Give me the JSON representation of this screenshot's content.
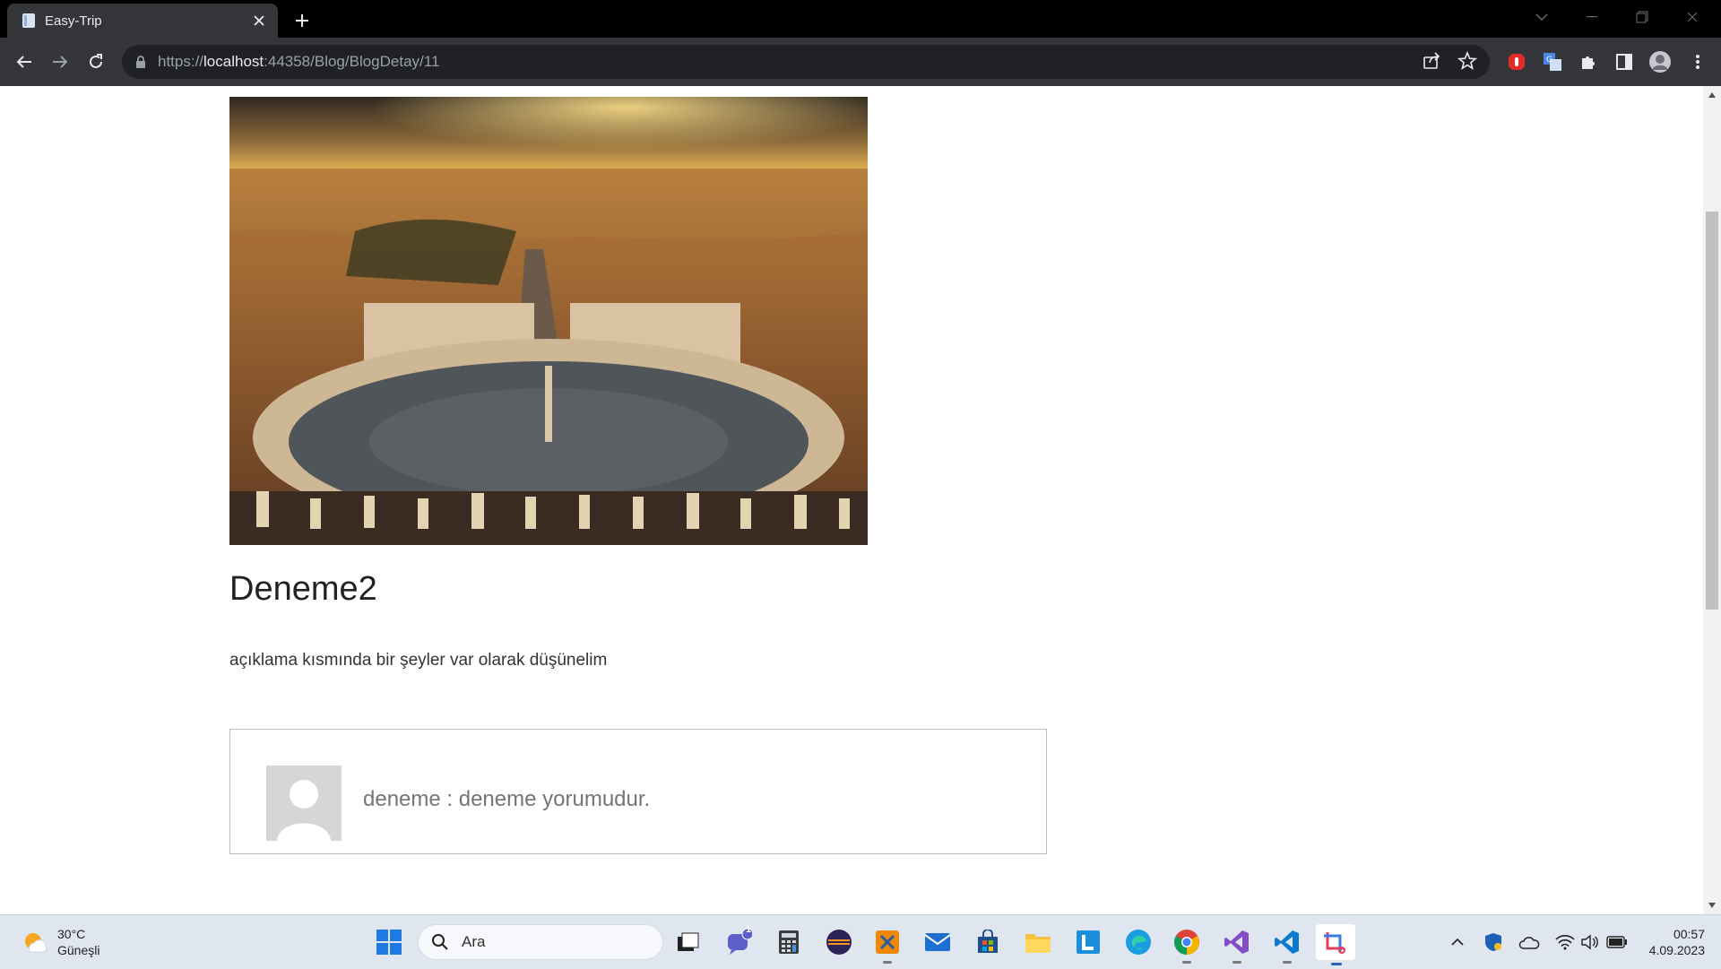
{
  "browser": {
    "tab_title": "Easy-Trip",
    "url_scheme": "https://",
    "url_host": "localhost",
    "url_rest": ":44358/Blog/BlogDetay/11"
  },
  "blog": {
    "title": "Deneme2",
    "description": "açıklama kısmında bir şeyler var olarak düşünelim",
    "image_alt": "Vatikan - Aziz Petrus Meydanı havadan görünüm"
  },
  "comment": {
    "text": "deneme : deneme yorumudur."
  },
  "taskbar": {
    "weather_temp": "30°C",
    "weather_desc": "Güneşli",
    "search_placeholder": "Ara",
    "teams_badge": "1",
    "time": "00:57",
    "date": "4.09.2023"
  },
  "colors": {
    "chrome_dark": "#35363a",
    "tab_strip": "#000000",
    "taskbar_bg": "#dfe6f0"
  }
}
